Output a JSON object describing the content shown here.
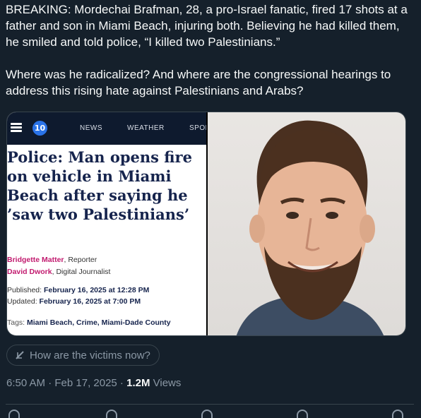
{
  "tweet": {
    "text": "BREAKING: Mordechai Brafman, 28, a pro-Israel fanatic, fired 17 shots at a father and son in Miami Beach, injuring both. Believing he had killed them, he smiled and told police, “I killed two Palestinians.”\n\nWhere was he radicalized? And where are the congressional hearings to address this rising hate against Palestinians and Arabs?"
  },
  "article": {
    "logo": "10",
    "nav": [
      "NEWS",
      "WEATHER",
      "SPOR"
    ],
    "headline": "Police: Man opens fire on vehicle in Miami Beach after saying he ’saw two Palestinians’",
    "authors": [
      {
        "name": "Bridgette Matter",
        "role": ", Reporter"
      },
      {
        "name": "David Dwork",
        "role": ", Digital Journalist"
      }
    ],
    "published_label": "Published: ",
    "published": "February 16, 2025 at 12:28 PM",
    "updated_label": "Updated: ",
    "updated": "February 16, 2025 at 7:00 PM",
    "tags_label": "Tags: ",
    "tags": "Miami Beach, Crime, Miami-Dade County"
  },
  "grok": {
    "prompt": "How are the victims now?",
    "icon": "grok-icon"
  },
  "meta": {
    "time": "6:50 AM · Feb 17, 2025 · ",
    "views_count": "1.2M",
    "views_label": " Views"
  },
  "colors": {
    "background": "#15202b",
    "secondary_text": "#8b98a5",
    "headline": "#16244d",
    "author": "#c21b6f"
  }
}
